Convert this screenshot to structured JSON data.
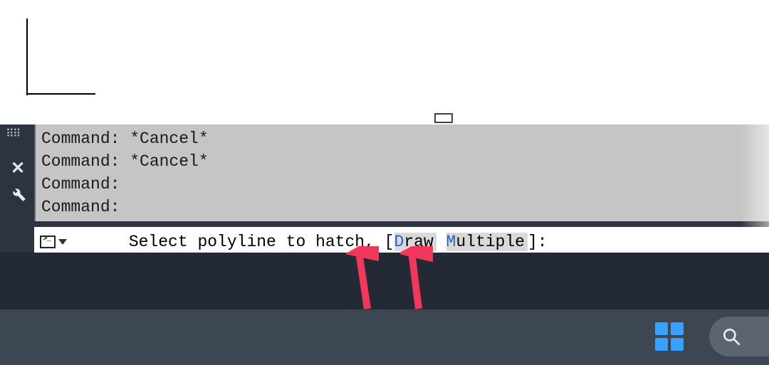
{
  "history": [
    {
      "label": "Command:",
      "value": " *Cancel*"
    },
    {
      "label": "Command:",
      "value": " *Cancel*"
    },
    {
      "label": "Command:",
      "value": ""
    },
    {
      "label": "Command:",
      "value": ""
    }
  ],
  "prompt": {
    "prefix": "Select polyline to hatch, [",
    "options": [
      {
        "hotkey": "D",
        "rest": "raw"
      },
      {
        "hotkey": "M",
        "rest": "ultiple"
      }
    ],
    "between_options": " ",
    "suffix": "]:"
  },
  "icons": {
    "close": "✕",
    "drag_dots": "⠿⠿"
  },
  "colors": {
    "panel_bg": "#2b3440",
    "history_bg": "#c5c5c5",
    "taskbar_bg": "#3d4754",
    "hotkey": "#2f5fd2",
    "arrow": "#f2385a"
  }
}
